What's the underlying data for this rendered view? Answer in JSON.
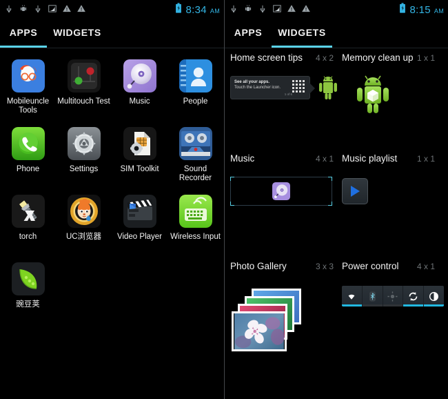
{
  "left_panel": {
    "statusbar": {
      "icons": [
        "usb-icon",
        "android-debug-icon",
        "usb-icon",
        "signal-icon",
        "warning-icon",
        "warning-icon"
      ],
      "time": "8:34",
      "ampm": "AM",
      "battery": "battery-charging-icon",
      "accent": "#33b5e5"
    },
    "tabs": [
      {
        "label": "APPS",
        "active": true
      },
      {
        "label": "WIDGETS",
        "active": false
      }
    ],
    "apps": [
      {
        "label": "Mobileuncle Tools",
        "icon": "mobileuncle-tools-icon"
      },
      {
        "label": "Multitouch Test",
        "icon": "multitouch-test-icon"
      },
      {
        "label": "Music",
        "icon": "music-icon"
      },
      {
        "label": "People",
        "icon": "people-icon"
      },
      {
        "label": "Phone",
        "icon": "phone-icon"
      },
      {
        "label": "Settings",
        "icon": "settings-icon"
      },
      {
        "label": "SIM Toolkit",
        "icon": "sim-toolkit-icon"
      },
      {
        "label": "Sound Recorder",
        "icon": "sound-recorder-icon"
      },
      {
        "label": "torch",
        "icon": "torch-icon"
      },
      {
        "label": "UC浏览器",
        "icon": "uc-browser-icon"
      },
      {
        "label": "Video Player",
        "icon": "video-player-icon"
      },
      {
        "label": "Wireless Input",
        "icon": "wireless-input-icon"
      },
      {
        "label": "豌豆荚",
        "icon": "wandoujia-icon"
      }
    ]
  },
  "right_panel": {
    "statusbar": {
      "icons": [
        "usb-icon",
        "android-debug-icon",
        "usb-icon",
        "signal-icon",
        "warning-icon",
        "warning-icon"
      ],
      "time": "8:15",
      "ampm": "AM",
      "battery": "battery-charging-icon",
      "accent": "#33b5e5"
    },
    "tabs": [
      {
        "label": "APPS",
        "active": false
      },
      {
        "label": "WIDGETS",
        "active": true
      }
    ],
    "widgets": [
      {
        "title": "Home screen tips",
        "size": "4 x 2",
        "tip": {
          "line1": "See all your apps.",
          "line2": "Touch the Launcher icon.",
          "counter": "1 of 6"
        }
      },
      {
        "title": "Memory clean up",
        "size": "1 x 1"
      },
      {
        "title": "Music",
        "size": "4 x 1"
      },
      {
        "title": "Music playlist",
        "size": "1 x 1"
      },
      {
        "title": "Photo Gallery",
        "size": "3 x 3"
      },
      {
        "title": "Power control",
        "size": "4 x 1",
        "toggles": [
          {
            "name": "wifi",
            "on": true
          },
          {
            "name": "bluetooth",
            "on": false
          },
          {
            "name": "gps",
            "on": false
          },
          {
            "name": "sync",
            "on": true
          },
          {
            "name": "brightness",
            "on": true
          }
        ]
      }
    ]
  }
}
